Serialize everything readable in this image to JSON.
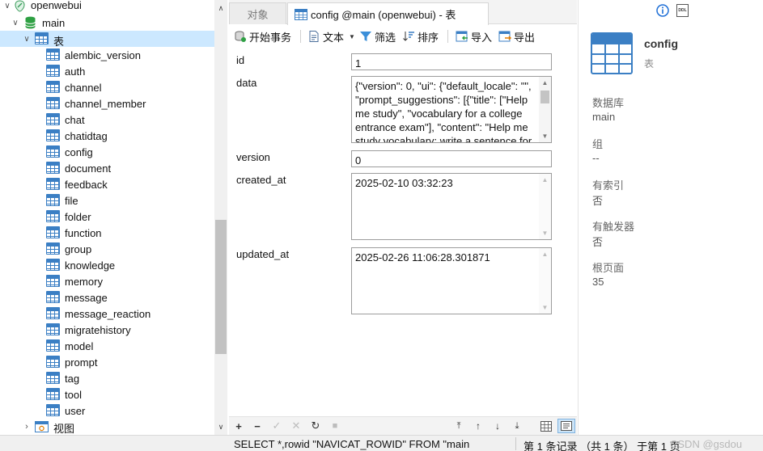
{
  "tree": {
    "connection": "openwebui",
    "database": "main",
    "tables_group": "表",
    "tables": [
      "alembic_version",
      "auth",
      "channel",
      "channel_member",
      "chat",
      "chatidtag",
      "config",
      "document",
      "feedback",
      "file",
      "folder",
      "function",
      "group",
      "knowledge",
      "memory",
      "message",
      "message_reaction",
      "migratehistory",
      "model",
      "prompt",
      "tag",
      "tool",
      "user"
    ],
    "views_group": "视图"
  },
  "tabs": {
    "objects": "对象",
    "active": "config @main (openwebui) - 表"
  },
  "toolbar": {
    "begin_transaction": "开始事务",
    "text": "文本",
    "filter": "筛选",
    "sort": "排序",
    "import": "导入",
    "export": "导出"
  },
  "fields": {
    "id": {
      "label": "id",
      "value": "1"
    },
    "data": {
      "label": "data",
      "value": "{\"version\": 0, \"ui\": {\"default_locale\": \"\", \"prompt_suggestions\": [{\"title\": [\"Help me study\", \"vocabulary for a college entrance exam\"], \"content\": \"Help me study vocabulary: write a sentence for"
    },
    "version": {
      "label": "version",
      "value": "0"
    },
    "created_at": {
      "label": "created_at",
      "value": "2025-02-10 03:32:23"
    },
    "updated_at": {
      "label": "updated_at",
      "value": "2025-02-26 11:06:28.301871"
    }
  },
  "info": {
    "title": "config",
    "subtitle": "表",
    "database_label": "数据库",
    "database_value": "main",
    "group_label": "组",
    "group_value": "--",
    "has_index_label": "有索引",
    "has_index_value": "否",
    "has_trigger_label": "有触发器",
    "has_trigger_value": "否",
    "root_page_label": "根页面",
    "root_page_value": "35",
    "ddl_icon_text": "DDL"
  },
  "status": {
    "sql": "SELECT *,rowid \"NAVICAT_ROWID\" FROM \"main",
    "records": "第 1 条记录 （共 1 条） 于第 1 页",
    "watermark": "CSDN @gsdou"
  },
  "colors": {
    "selection": "#cce8ff",
    "table_icon": "#3b7fc4",
    "db_icon": "#2ea043"
  }
}
